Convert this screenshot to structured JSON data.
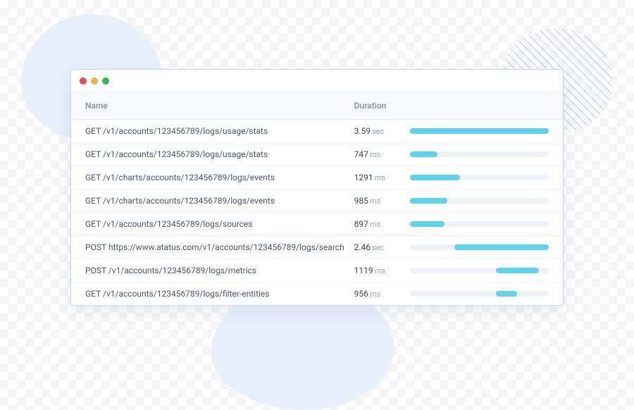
{
  "table": {
    "headers": {
      "name": "Name",
      "duration": "Duration"
    },
    "rows": [
      {
        "name": "GET /v1/accounts/123456789/logs/usage/stats",
        "duration_value": "3.59",
        "duration_unit": "sec",
        "bar_offset_pct": 0,
        "bar_width_pct": 100
      },
      {
        "name": "GET /v1/accounts/123456789/logs/usage/stats",
        "duration_value": "747",
        "duration_unit": "ms",
        "bar_offset_pct": 0,
        "bar_width_pct": 20
      },
      {
        "name": "GET /v1/charts/accounts/123456789/logs/events",
        "duration_value": "1291",
        "duration_unit": "ms",
        "bar_offset_pct": 0,
        "bar_width_pct": 36
      },
      {
        "name": "GET /v1/charts/accounts/123456789/logs/events",
        "duration_value": "985",
        "duration_unit": "ms",
        "bar_offset_pct": 0,
        "bar_width_pct": 27
      },
      {
        "name": "GET /v1/accounts/123456789/logs/sources",
        "duration_value": "897",
        "duration_unit": "ms",
        "bar_offset_pct": 0,
        "bar_width_pct": 25
      },
      {
        "name": "POST https://www.atatus.com/v1/accounts/123456789/logs/search",
        "duration_value": "2.46",
        "duration_unit": "sec",
        "bar_offset_pct": 32,
        "bar_width_pct": 68
      },
      {
        "name": "POST /v1/accounts/123456789/logs/metrics",
        "duration_value": "1119",
        "duration_unit": "ms",
        "bar_offset_pct": 62,
        "bar_width_pct": 31
      },
      {
        "name": "GET /v1/accounts/123456789/logs/filter-entities",
        "duration_value": "956",
        "duration_unit": "ms",
        "bar_offset_pct": 62,
        "bar_width_pct": 15
      }
    ]
  }
}
